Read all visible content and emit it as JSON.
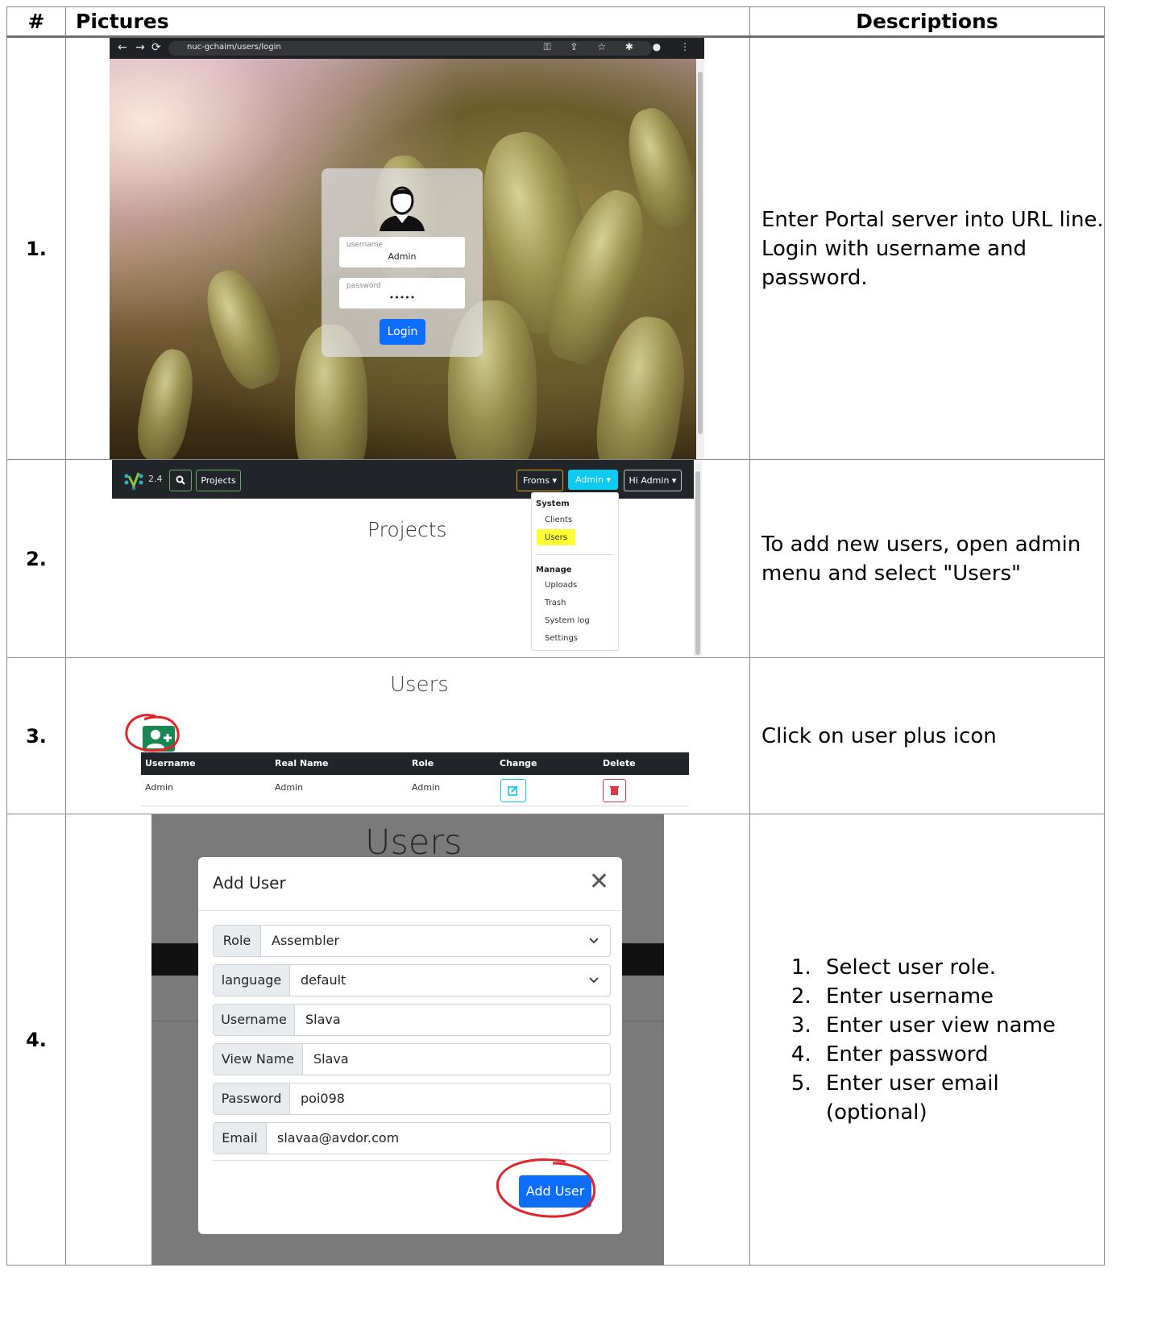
{
  "table": {
    "header_num": "#",
    "header_pictures": "Pictures",
    "header_descriptions": "Descriptions"
  },
  "rows": [
    {
      "num": "1.",
      "desc_lines": [
        "Enter Portal server into URL line.",
        "Login with username and password."
      ],
      "screenshot": {
        "url": "nuc-gchaim/users/login",
        "username_label": "username",
        "username_value": "Admin",
        "password_label": "password",
        "password_value": "•••••",
        "login_button": "Login"
      }
    },
    {
      "num": "2.",
      "desc_lines": [
        "To add new users, open admin",
        "menu and select \"Users\""
      ],
      "screenshot": {
        "version": "2.4",
        "projects_button": "Projects",
        "froms_button": "Froms",
        "admin_button": "Admin",
        "hi_button": "Hi Admin",
        "page_title": "Projects",
        "menu": {
          "system_header": "System",
          "clients": "Clients",
          "users": "Users",
          "manage_header": "Manage",
          "uploads": "Uploads",
          "trash": "Trash",
          "system_log": "System log",
          "settings": "Settings"
        }
      }
    },
    {
      "num": "3.",
      "desc_lines": [
        "Click on user plus icon"
      ],
      "screenshot": {
        "page_title": "Users",
        "columns": [
          "Username",
          "Real Name",
          "Role",
          "Change",
          "Delete"
        ],
        "row": [
          "Admin",
          "Admin",
          "Admin"
        ]
      }
    },
    {
      "num": "4.",
      "desc_list": [
        "Select user role.",
        "Enter username",
        "Enter user view name",
        "Enter password",
        "Enter user email (optional)"
      ],
      "screenshot": {
        "background_title": "Users",
        "modal_title": "Add User",
        "fields": [
          {
            "label": "Role",
            "value": "Assembler"
          },
          {
            "label": "language",
            "value": "default"
          },
          {
            "label": "Username",
            "value": "Slava"
          },
          {
            "label": "View Name",
            "value": "Slava"
          },
          {
            "label": "Password",
            "value": "poi098"
          },
          {
            "label": "Email",
            "value": "slavaa@avdor.com"
          }
        ],
        "submit_button": "Add User"
      }
    }
  ],
  "colors": {
    "bootstrap_primary": "#0d6efd",
    "navbar_dark": "#212529",
    "success": "#198754",
    "annotation_red": "#e0252b",
    "highlight_yellow": "#ffff33"
  }
}
